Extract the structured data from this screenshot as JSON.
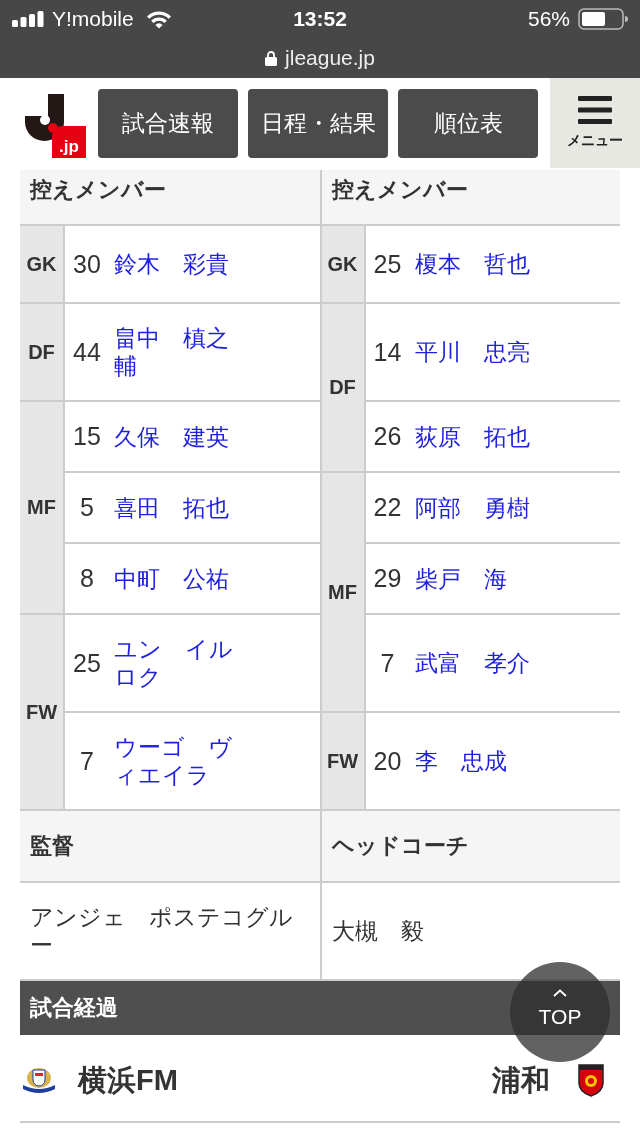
{
  "status_bar": {
    "carrier": "Y!mobile",
    "time": "13:52",
    "battery": "56%"
  },
  "address_bar": {
    "url": "jleague.jp"
  },
  "header": {
    "logo_text": ".jp",
    "nav_buttons": [
      "試合速報",
      "日程・結果",
      "順位表"
    ],
    "menu_label": "メニュー"
  },
  "substitutes": [
    {
      "heading": "控えメンバー",
      "groups": [
        {
          "position": "GK",
          "players": [
            {
              "number": "30",
              "name": "鈴木　彩貴"
            }
          ]
        },
        {
          "position": "DF",
          "players": [
            {
              "number": "44",
              "name": "畠中　槙之輔"
            }
          ]
        },
        {
          "position": "MF",
          "players": [
            {
              "number": "15",
              "name": "久保　建英"
            },
            {
              "number": "5",
              "name": "喜田　拓也"
            },
            {
              "number": "8",
              "name": "中町　公祐"
            }
          ]
        },
        {
          "position": "FW",
          "players": [
            {
              "number": "25",
              "name": "ユン　イルロク"
            },
            {
              "number": "7",
              "name": "ウーゴ　ヴィエイラ"
            }
          ]
        }
      ]
    },
    {
      "heading": "控えメンバー",
      "groups": [
        {
          "position": "GK",
          "players": [
            {
              "number": "25",
              "name": "榎本　哲也"
            }
          ]
        },
        {
          "position": "DF",
          "players": [
            {
              "number": "14",
              "name": "平川　忠亮"
            },
            {
              "number": "26",
              "name": "荻原　拓也"
            }
          ]
        },
        {
          "position": "MF",
          "players": [
            {
              "number": "22",
              "name": "阿部　勇樹"
            },
            {
              "number": "29",
              "name": "柴戸　海"
            },
            {
              "number": "7",
              "name": "武富　孝介"
            }
          ]
        },
        {
          "position": "FW",
          "players": [
            {
              "number": "20",
              "name": "李　忠成"
            }
          ]
        }
      ]
    }
  ],
  "staff": [
    {
      "heading": "監督",
      "name": "アンジェ　ポステコグルー"
    },
    {
      "heading": "ヘッドコーチ",
      "name": "大槻　毅"
    }
  ],
  "match_progress": {
    "title": "試合経過",
    "home_team": "横浜FM",
    "away_team": "浦和"
  },
  "back_to_top": {
    "label": "TOP"
  }
}
